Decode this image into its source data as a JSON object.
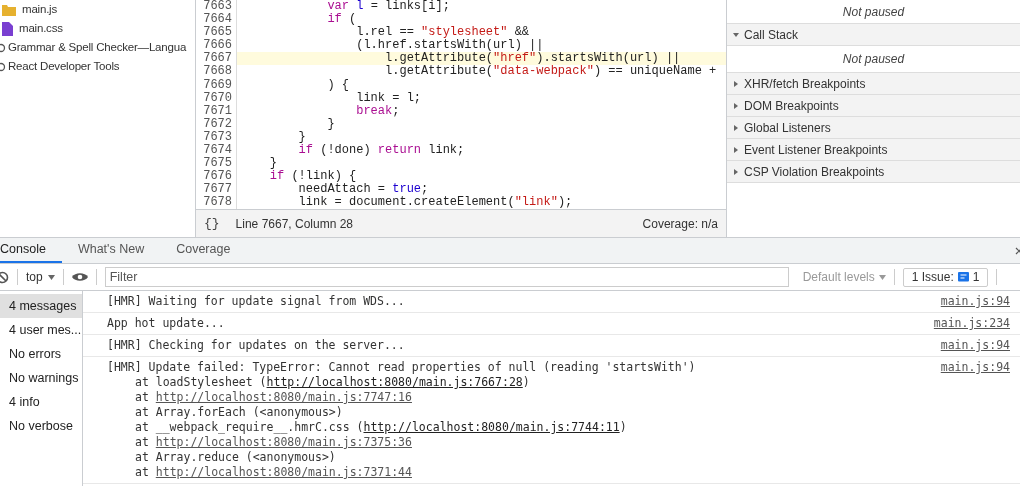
{
  "files": [
    {
      "name": "main.js",
      "kind": "js"
    },
    {
      "name": "main.css",
      "kind": "css"
    },
    {
      "name": "Grammar & Spell Checker—Langua",
      "kind": "extension"
    },
    {
      "name": "React Developer Tools",
      "kind": "extension"
    }
  ],
  "editor": {
    "lines": [
      {
        "number": "7663",
        "highlighted": false,
        "tokens": [
          {
            "kind": "keyword",
            "text": "            var"
          },
          {
            "kind": "literal",
            "text": " l"
          },
          {
            "kind": "plain",
            "text": " = links[i];"
          }
        ]
      },
      {
        "number": "7664",
        "highlighted": false,
        "tokens": [
          {
            "kind": "keyword",
            "text": "            if"
          },
          {
            "kind": "plain",
            "text": " ("
          }
        ]
      },
      {
        "number": "7665",
        "highlighted": false,
        "tokens": [
          {
            "kind": "plain",
            "text": "                l.rel == "
          },
          {
            "kind": "string",
            "text": "\"stylesheet\""
          },
          {
            "kind": "plain",
            "text": " &&"
          }
        ]
      },
      {
        "number": "7666",
        "highlighted": false,
        "tokens": [
          {
            "kind": "plain",
            "text": "                (l.href.startsWith(url) ||"
          }
        ]
      },
      {
        "number": "7667",
        "highlighted": true,
        "tokens": [
          {
            "kind": "plain",
            "text": "                    l.getAttribute("
          },
          {
            "kind": "string",
            "text": "\"href\""
          },
          {
            "kind": "plain",
            "text": ").startsWith(url) ||"
          }
        ]
      },
      {
        "number": "7668",
        "highlighted": false,
        "tokens": [
          {
            "kind": "plain",
            "text": "                    l.getAttribute("
          },
          {
            "kind": "string",
            "text": "\"data-webpack\""
          },
          {
            "kind": "plain",
            "text": ") == uniqueName +"
          }
        ]
      },
      {
        "number": "7669",
        "highlighted": false,
        "tokens": [
          {
            "kind": "plain",
            "text": "            ) {"
          }
        ]
      },
      {
        "number": "7670",
        "highlighted": false,
        "tokens": [
          {
            "kind": "plain",
            "text": "                link = l;"
          }
        ]
      },
      {
        "number": "7671",
        "highlighted": false,
        "tokens": [
          {
            "kind": "keyword",
            "text": "                break"
          },
          {
            "kind": "plain",
            "text": ";"
          }
        ]
      },
      {
        "number": "7672",
        "highlighted": false,
        "tokens": [
          {
            "kind": "plain",
            "text": "            }"
          }
        ]
      },
      {
        "number": "7673",
        "highlighted": false,
        "tokens": [
          {
            "kind": "plain",
            "text": "        }"
          }
        ]
      },
      {
        "number": "7674",
        "highlighted": false,
        "tokens": [
          {
            "kind": "keyword",
            "text": "        if"
          },
          {
            "kind": "plain",
            "text": " (!done) "
          },
          {
            "kind": "keyword",
            "text": "return"
          },
          {
            "kind": "plain",
            "text": " link;"
          }
        ]
      },
      {
        "number": "7675",
        "highlighted": false,
        "tokens": [
          {
            "kind": "plain",
            "text": "    }"
          }
        ]
      },
      {
        "number": "7676",
        "highlighted": false,
        "tokens": [
          {
            "kind": "keyword",
            "text": "    if"
          },
          {
            "kind": "plain",
            "text": " (!link) {"
          }
        ]
      },
      {
        "number": "7677",
        "highlighted": false,
        "tokens": [
          {
            "kind": "plain",
            "text": "        needAttach = "
          },
          {
            "kind": "literal",
            "text": "true"
          },
          {
            "kind": "plain",
            "text": ";"
          }
        ]
      },
      {
        "number": "7678",
        "highlighted": false,
        "tokens": [
          {
            "kind": "plain",
            "text": "        link = document.createElement("
          },
          {
            "kind": "string",
            "text": "\"link\""
          },
          {
            "kind": "plain",
            "text": ");"
          }
        ]
      }
    ],
    "format_button": "{}",
    "position": "Line 7667, Column 28",
    "coverage": "Coverage: n/a"
  },
  "debugger": {
    "top_message": "Not paused",
    "sections": [
      {
        "title": "Call Stack",
        "expanded": true,
        "message": "Not paused"
      },
      {
        "title": "XHR/fetch Breakpoints",
        "expanded": false
      },
      {
        "title": "DOM Breakpoints",
        "expanded": false
      },
      {
        "title": "Global Listeners",
        "expanded": false
      },
      {
        "title": "Event Listener Breakpoints",
        "expanded": false
      },
      {
        "title": "CSP Violation Breakpoints",
        "expanded": false
      }
    ]
  },
  "drawer_tabs": [
    {
      "label": "Console",
      "selected": true
    },
    {
      "label": "What's New",
      "selected": false
    },
    {
      "label": "Coverage",
      "selected": false
    }
  ],
  "toolbar": {
    "context": "top",
    "filter_placeholder": "Filter",
    "levels": "Default levels",
    "issues_label": "1 Issue:",
    "issues_count": "1"
  },
  "console_sidebar": [
    {
      "label": "4 messages",
      "selected": true
    },
    {
      "label": "4 user mes...",
      "selected": false
    },
    {
      "label": "No errors",
      "selected": false
    },
    {
      "label": "No warnings",
      "selected": false
    },
    {
      "label": "4 info",
      "selected": false
    },
    {
      "label": "No verbose",
      "selected": false
    }
  ],
  "messages": [
    {
      "text": "[HMR] Waiting for update signal from WDS...",
      "source": "main.js:94"
    },
    {
      "text": "App hot update...",
      "source": "main.js:234"
    },
    {
      "text": "[HMR] Checking for updates on the server...",
      "source": "main.js:94"
    },
    {
      "text": "[HMR] Update failed: TypeError: Cannot read properties of null (reading 'startsWith')",
      "source": "main.js:94",
      "stack": [
        {
          "before": "at loadStylesheet (",
          "link": "http://localhost:8080/main.js:7667:28",
          "after": ")"
        },
        {
          "before": "at ",
          "link": "http://localhost:8080/main.js:7747:16"
        },
        {
          "before": "at Array.forEach (<anonymous>)"
        },
        {
          "before": "at __webpack_require__.hmrC.css (",
          "link": "http://localhost:8080/main.js:7744:11",
          "after": ")"
        },
        {
          "before": "at ",
          "link": "http://localhost:8080/main.js:7375:36"
        },
        {
          "before": "at Array.reduce (<anonymous>)"
        },
        {
          "before": "at ",
          "link": "http://localhost:8080/main.js:7371:44"
        }
      ]
    }
  ]
}
